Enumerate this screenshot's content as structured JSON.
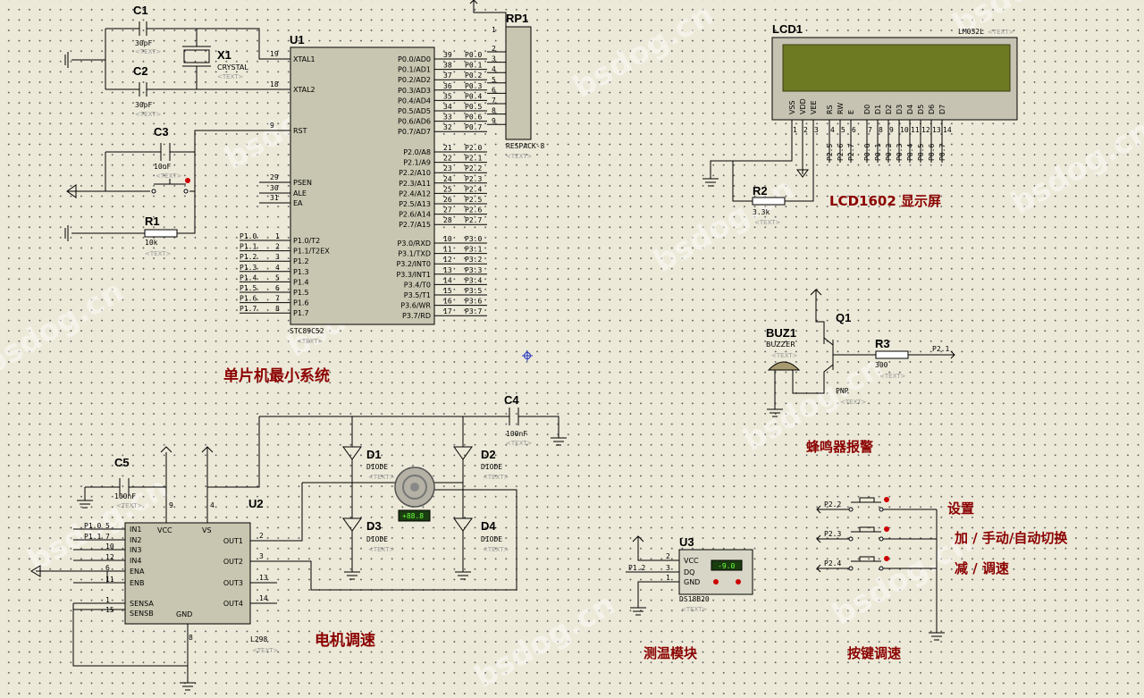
{
  "components": {
    "c1": {
      "ref": "C1",
      "value": "30pF"
    },
    "c2": {
      "ref": "C2",
      "value": "30pF"
    },
    "c3": {
      "ref": "C3",
      "value": "10uF"
    },
    "c4": {
      "ref": "C4",
      "value": "100nF"
    },
    "c5": {
      "ref": "C5",
      "value": "100nF"
    },
    "x1": {
      "ref": "X1",
      "value": "CRYSTAL"
    },
    "r1": {
      "ref": "R1",
      "value": "10k"
    },
    "r2": {
      "ref": "R2",
      "value": "3.3k"
    },
    "r3": {
      "ref": "R3",
      "value": "300"
    },
    "u1": {
      "ref": "U1",
      "value": "STC89C52"
    },
    "rp1": {
      "ref": "RP1",
      "value": "RESPACK-8"
    },
    "lcd1": {
      "ref": "LCD1",
      "value": "LM032L"
    },
    "buz1": {
      "ref": "BUZ1",
      "value": "BUZZER"
    },
    "q1": {
      "ref": "Q1",
      "value": "PNP"
    },
    "u2": {
      "ref": "U2",
      "value": "L298"
    },
    "u3": {
      "ref": "U3",
      "value": "DS18B20",
      "display": "-9.0"
    },
    "d1": {
      "ref": "D1",
      "value": "DIODE"
    },
    "d2": {
      "ref": "D2",
      "value": "DIODE"
    },
    "d3": {
      "ref": "D3",
      "value": "DIODE"
    },
    "d4": {
      "ref": "D4",
      "value": "DIODE"
    },
    "motor": {
      "display": "+88.8"
    }
  },
  "text_placeholder": "<TEXT>",
  "u1_pins": {
    "left_top": [
      {
        "num": "19",
        "name": "XTAL1"
      },
      {
        "num": "18",
        "name": "XTAL2"
      },
      {
        "num": "9",
        "name": "RST"
      },
      {
        "num": "29",
        "name": "PSEN"
      },
      {
        "num": "30",
        "name": "ALE"
      },
      {
        "num": "31",
        "name": "EA"
      }
    ],
    "p1": [
      {
        "num": "1",
        "name": "P1.0/T2",
        "net": "P1.0"
      },
      {
        "num": "2",
        "name": "P1.1/T2EX",
        "net": "P1.1"
      },
      {
        "num": "3",
        "name": "P1.2",
        "net": "P1.2"
      },
      {
        "num": "4",
        "name": "P1.3",
        "net": "P1.3"
      },
      {
        "num": "5",
        "name": "P1.4",
        "net": "P1.4"
      },
      {
        "num": "6",
        "name": "P1.5",
        "net": "P1.5"
      },
      {
        "num": "7",
        "name": "P1.6",
        "net": "P1.6"
      },
      {
        "num": "8",
        "name": "P1.7",
        "net": "P1.7"
      }
    ],
    "p0": [
      {
        "num": "39",
        "name": "P0.0/AD0",
        "net": "P0.0"
      },
      {
        "num": "38",
        "name": "P0.1/AD1",
        "net": "P0.1"
      },
      {
        "num": "37",
        "name": "P0.2/AD2",
        "net": "P0.2"
      },
      {
        "num": "36",
        "name": "P0.3/AD3",
        "net": "P0.3"
      },
      {
        "num": "35",
        "name": "P0.4/AD4",
        "net": "P0.4"
      },
      {
        "num": "34",
        "name": "P0.5/AD5",
        "net": "P0.5"
      },
      {
        "num": "33",
        "name": "P0.6/AD6",
        "net": "P0.6"
      },
      {
        "num": "32",
        "name": "P0.7/AD7",
        "net": "P0.7"
      }
    ],
    "p2": [
      {
        "num": "21",
        "name": "P2.0/A8",
        "net": "P2.0"
      },
      {
        "num": "22",
        "name": "P2.1/A9",
        "net": "P2.1"
      },
      {
        "num": "23",
        "name": "P2.2/A10",
        "net": "P2.2"
      },
      {
        "num": "24",
        "name": "P2.3/A11",
        "net": "P2.3"
      },
      {
        "num": "25",
        "name": "P2.4/A12",
        "net": "P2.4"
      },
      {
        "num": "26",
        "name": "P2.5/A13",
        "net": "P2.5"
      },
      {
        "num": "27",
        "name": "P2.6/A14",
        "net": "P2.6"
      },
      {
        "num": "28",
        "name": "P2.7/A15",
        "net": "P2.7"
      }
    ],
    "p3": [
      {
        "num": "10",
        "name": "P3.0/RXD",
        "net": "P3.0"
      },
      {
        "num": "11",
        "name": "P3.1/TXD",
        "net": "P3.1"
      },
      {
        "num": "12",
        "name": "P3.2/INT0",
        "net": "P3.2"
      },
      {
        "num": "13",
        "name": "P3.3/INT1",
        "net": "P3.3"
      },
      {
        "num": "14",
        "name": "P3.4/T0",
        "net": "P3.4"
      },
      {
        "num": "15",
        "name": "P3.5/T1",
        "net": "P3.5"
      },
      {
        "num": "16",
        "name": "P3.6/WR",
        "net": "P3.6"
      },
      {
        "num": "17",
        "name": "P3.7/RD",
        "net": "P3.7"
      }
    ]
  },
  "rp1_pins": [
    "1",
    "2",
    "3",
    "4",
    "5",
    "6",
    "7",
    "8",
    "9"
  ],
  "lcd_pins": [
    {
      "name": "VSS",
      "num": "1",
      "net": ""
    },
    {
      "name": "VDD",
      "num": "2",
      "net": ""
    },
    {
      "name": "VEE",
      "num": "3",
      "net": ""
    },
    {
      "name": "RS",
      "num": "4",
      "net": "P2.5"
    },
    {
      "name": "RW",
      "num": "5",
      "net": "P2.6"
    },
    {
      "name": "E",
      "num": "6",
      "net": "P2.7"
    },
    {
      "name": "D0",
      "num": "7",
      "net": "P0.0"
    },
    {
      "name": "D1",
      "num": "8",
      "net": "P0.1"
    },
    {
      "name": "D2",
      "num": "9",
      "net": "P0.2"
    },
    {
      "name": "D3",
      "num": "10",
      "net": "P0.3"
    },
    {
      "name": "D4",
      "num": "11",
      "net": "P0.4"
    },
    {
      "name": "D5",
      "num": "12",
      "net": "P0.5"
    },
    {
      "name": "D6",
      "num": "13",
      "net": "P0.6"
    },
    {
      "name": "D7",
      "num": "14",
      "net": "P0.7"
    }
  ],
  "u2_pins": {
    "left": [
      {
        "num": "5",
        "name": "IN1",
        "net": "P1.0"
      },
      {
        "num": "7",
        "name": "IN2",
        "net": "P1.1"
      },
      {
        "num": "10",
        "name": "IN3",
        "net": ""
      },
      {
        "num": "12",
        "name": "IN4",
        "net": ""
      },
      {
        "num": "6",
        "name": "ENA",
        "net": ""
      },
      {
        "num": "11",
        "name": "ENB",
        "net": ""
      },
      {
        "num": "1",
        "name": "SENSA",
        "net": ""
      },
      {
        "num": "15",
        "name": "SENSB",
        "net": ""
      }
    ],
    "right": [
      {
        "num": "2",
        "name": "OUT1"
      },
      {
        "num": "3",
        "name": "OUT2"
      },
      {
        "num": "13",
        "name": "OUT3"
      },
      {
        "num": "14",
        "name": "OUT4"
      }
    ],
    "vcc": "VCC",
    "vs": "VS",
    "gnd": "GND",
    "vcc_num": "9",
    "vs_num": "4",
    "gnd_num": "8"
  },
  "u3_pins": [
    {
      "num": "2",
      "name": "VCC",
      "net": ""
    },
    {
      "num": "3",
      "name": "DQ",
      "net": "P1.2"
    },
    {
      "num": "1",
      "name": "GND",
      "net": ""
    }
  ],
  "r3_net": "P2.1",
  "buttons": [
    {
      "net": "P2.2",
      "label": "设置"
    },
    {
      "net": "P2.3",
      "label": "加 / 手动/自动切换"
    },
    {
      "net": "P2.4",
      "label": "减 / 调速"
    }
  ],
  "captions": {
    "mcu": "单片机最小系统",
    "lcd": "LCD1602 显示屏",
    "buzzer": "蜂鸣器报警",
    "motor": "电机调速",
    "temp": "测温模块",
    "keys": "按键调速"
  },
  "watermark": "bsdog.cn"
}
